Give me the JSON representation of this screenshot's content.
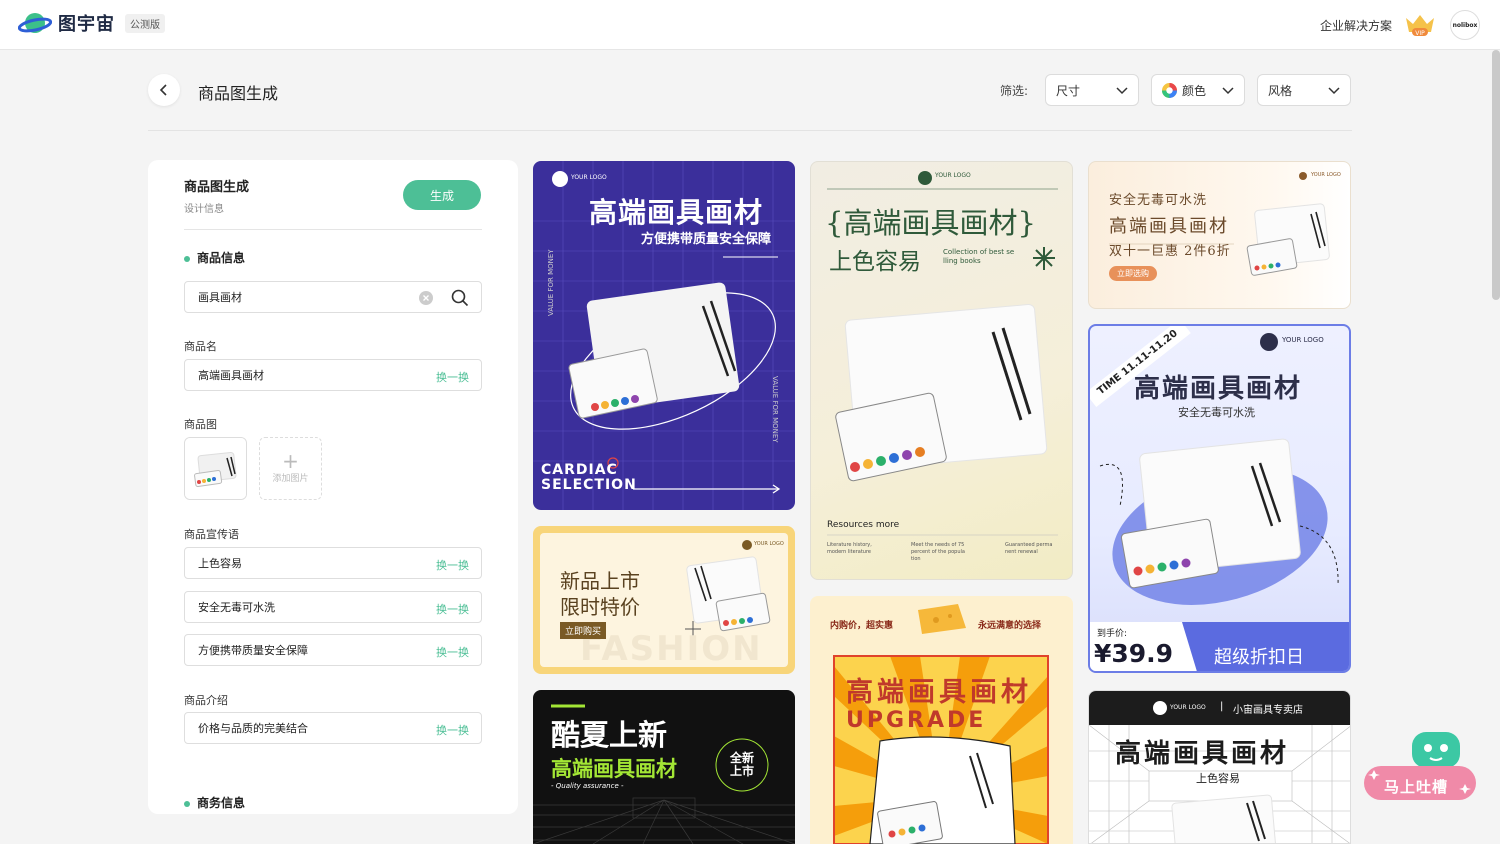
{
  "header": {
    "app_name": "图宇宙",
    "beta_tag": "公测版",
    "enterprise": "企业解决方案",
    "vip_badge": "VIP",
    "avatar_text": "nolibox"
  },
  "toolbar": {
    "page_title": "商品图生成",
    "filter_label": "筛选:",
    "filters": [
      {
        "label": "尺寸"
      },
      {
        "label": "颜色"
      },
      {
        "label": "风格"
      }
    ]
  },
  "panel": {
    "title": "商品图生成",
    "subtitle": "设计信息",
    "generate_label": "生成",
    "product_info_heading": "商品信息",
    "search_value": "画具画材",
    "name_label": "商品名",
    "name_value": "高端画具画材",
    "swap_label": "换一换",
    "image_label": "商品图",
    "add_image_label": "添加图片",
    "slogan_label": "商品宣传语",
    "slogans": [
      {
        "text": "上色容易",
        "swap": "换一换"
      },
      {
        "text": "安全无毒可水洗",
        "swap": "换一换"
      },
      {
        "text": "方便携带质量安全保障",
        "swap": "换一换"
      }
    ],
    "intro_label": "商品介绍",
    "intro_value": "价格与品质的完美结合",
    "business_heading": "商务信息"
  },
  "cards": {
    "c1": {
      "logo": "YOUR LOGO",
      "title": "高端画具画材",
      "subtitle": "方便携带质量安全保障",
      "side_left": "VALUE FOR MONEY",
      "side_right": "VALUE FOR MONEY",
      "footer_line1": "CARDIAC",
      "footer_line2": "SELECTION"
    },
    "c2": {
      "logo": "YOUR LOGO",
      "title": "{高端画具画材}",
      "subtitle": "上色容易",
      "small_en": "Collection of best se lling books",
      "resources": "Resources more",
      "foot1": "Literature history, modern literature",
      "foot2": "Meet the needs of 75 percent of the popula tion",
      "foot3": "Guaranteed perma nent renewal"
    },
    "c3": {
      "logo": "YOUR LOGO",
      "line1": "安全无毒可水洗",
      "line2": "高端画具画材",
      "line3": "双十一巨惠 2件6折",
      "button": "立即选购"
    },
    "c4": {
      "logo": "YOUR LOGO",
      "line1": "新品上市",
      "line2": "限时特价",
      "button": "立即购买",
      "bg_word": "FASHION"
    },
    "c5": {
      "logo": "YOUR LOGO",
      "ribbon": "TIME 11.11-11.20",
      "title": "高端画具画材",
      "subtitle": "安全无毒可水洗",
      "price_label": "到手价:",
      "price": "¥39.9",
      "promo": "超级折扣日"
    },
    "c6": {
      "tag_left": "内购价，超实惠",
      "tag_right": "永远满意的选择",
      "title": "高端画具画材",
      "title_en": "UPGRADE"
    },
    "c7": {
      "title": "酷夏上新",
      "subtitle": "高端画具画材",
      "tagline": "- Quality assurance -",
      "badge": "全新上市"
    },
    "c8": {
      "logo": "YOUR LOGO",
      "shop": "小宙画具专卖店",
      "title": "高端画具画材",
      "subtitle": "上色容易"
    }
  },
  "feedback": {
    "label": "马上吐槽"
  },
  "colors": {
    "accent": "#4dbf96",
    "purple": "#3b2f9b",
    "blue": "#6c7de6"
  }
}
